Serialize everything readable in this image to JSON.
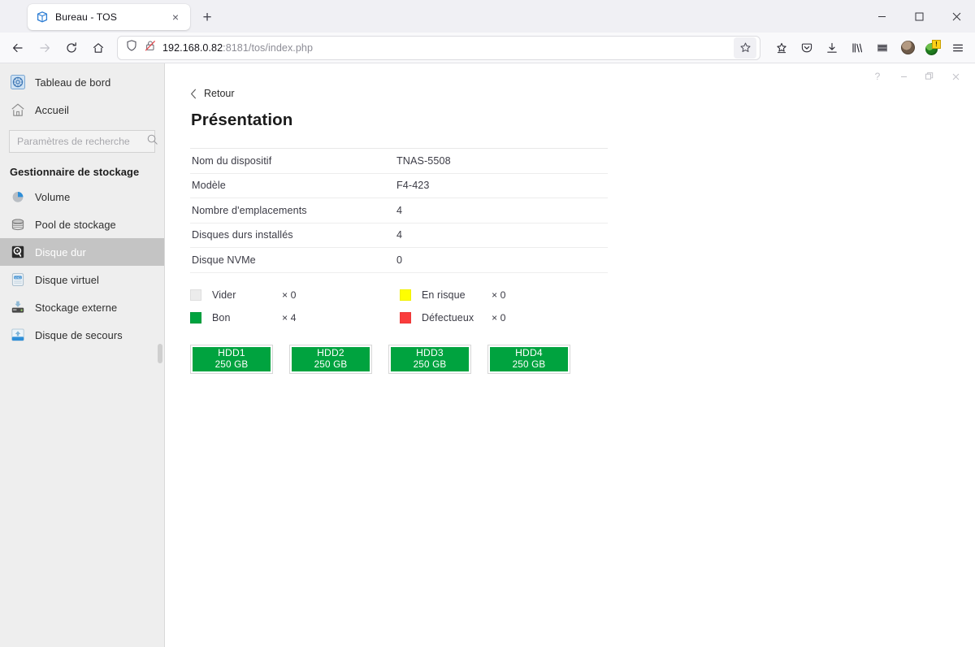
{
  "browser": {
    "tab": {
      "title": "Bureau - TOS",
      "favicon_name": "tos-cube-favicon",
      "close_label": "×"
    },
    "new_tab_label": "+",
    "window_controls": {
      "minimize": "–",
      "maximize": "□",
      "close": "×"
    },
    "nav": {
      "back": "←",
      "forward": "→",
      "reload": "↻",
      "home": "⌂"
    },
    "url": {
      "host": "192.168.0.82",
      "rest": ":8181/tos/index.php",
      "shield_icon": "shield-icon",
      "insecure_icon": "insecure-lock-icon",
      "bookmark_icon": "star-outline-icon"
    },
    "toolbar_icons": [
      "save-to-pocket-icon",
      "pocket-icon",
      "downloads-icon",
      "library-icon",
      "container-tabs-icon",
      "account-avatar-icon",
      "extension-globe-icon",
      "app-menu-icon"
    ],
    "extension_badge": "!"
  },
  "pane_controls": {
    "help": "?",
    "minimize": "–",
    "restore": "❐",
    "close": "×"
  },
  "sidebar": {
    "top_items": [
      {
        "label": "Tableau de bord",
        "icon": "dashboard-icon"
      },
      {
        "label": "Accueil",
        "icon": "home-icon"
      }
    ],
    "search": {
      "placeholder": "Paramètres de recherche",
      "value": "",
      "icon": "search-icon"
    },
    "section_title": "Gestionnaire de stockage",
    "items": [
      {
        "label": "Volume",
        "icon": "volume-pie-icon",
        "selected": false
      },
      {
        "label": "Pool de stockage",
        "icon": "storage-pool-icon",
        "selected": false
      },
      {
        "label": "Disque dur",
        "icon": "hard-disk-icon",
        "selected": true
      },
      {
        "label": "Disque virtuel",
        "icon": "virtual-disk-icon",
        "selected": false
      },
      {
        "label": "Stockage externe",
        "icon": "external-storage-icon",
        "selected": false
      },
      {
        "label": "Disque de secours",
        "icon": "spare-disk-icon",
        "selected": false
      }
    ]
  },
  "main": {
    "back_label": "Retour",
    "title": "Présentation",
    "info_rows": [
      {
        "label": "Nom du dispositif",
        "value": "TNAS-5508"
      },
      {
        "label": "Modèle",
        "value": "F4-423"
      },
      {
        "label": "Nombre d'emplacements",
        "value": "4"
      },
      {
        "label": "Disques durs installés",
        "value": "4"
      },
      {
        "label": "Disque NVMe",
        "value": "0"
      }
    ],
    "legend": [
      {
        "label": "Vider",
        "count": "× 0",
        "color": "#ececec"
      },
      {
        "label": "En risque",
        "count": "× 0",
        "color": "#ffff00"
      },
      {
        "label": "Bon",
        "count": "× 4",
        "color": "#00a33f"
      },
      {
        "label": "Défectueux",
        "count": "× 0",
        "color": "#fa3c3c"
      }
    ],
    "disks": [
      {
        "name": "HDD1",
        "size": "250 GB",
        "color": "#00a33f"
      },
      {
        "name": "HDD2",
        "size": "250 GB",
        "color": "#00a33f"
      },
      {
        "name": "HDD3",
        "size": "250 GB",
        "color": "#00a33f"
      },
      {
        "name": "HDD4",
        "size": "250 GB",
        "color": "#00a33f"
      }
    ]
  }
}
